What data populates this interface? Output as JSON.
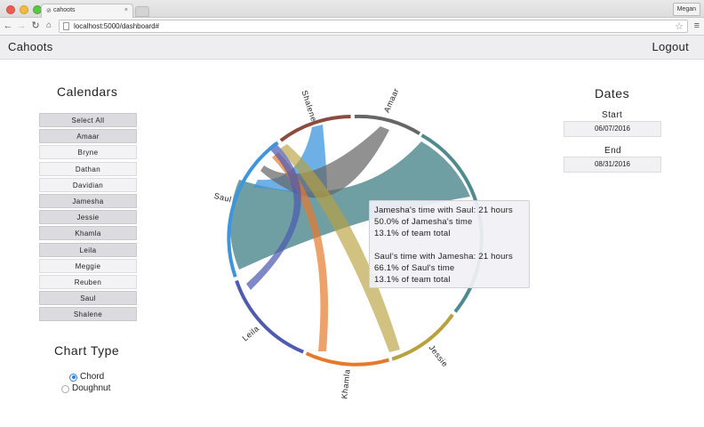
{
  "browser": {
    "tab_title": "cahoots",
    "tab_close": "×",
    "user_button": "Megan",
    "url": "localhost:5000/dashboard#"
  },
  "app": {
    "brand": "Cahoots",
    "logout": "Logout"
  },
  "calendars": {
    "heading": "Calendars",
    "select_all": "Select All",
    "items": [
      {
        "label": "Amaar",
        "selected": true
      },
      {
        "label": "Bryne",
        "selected": false
      },
      {
        "label": "Dathan",
        "selected": false
      },
      {
        "label": "Davidian",
        "selected": false
      },
      {
        "label": "Jamesha",
        "selected": true
      },
      {
        "label": "Jessie",
        "selected": true
      },
      {
        "label": "Khamla",
        "selected": true
      },
      {
        "label": "Leila",
        "selected": true
      },
      {
        "label": "Meggie",
        "selected": false
      },
      {
        "label": "Reuben",
        "selected": false
      },
      {
        "label": "Saul",
        "selected": true
      },
      {
        "label": "Shalene",
        "selected": true
      }
    ]
  },
  "chart_type": {
    "heading": "Chart Type",
    "options": [
      {
        "label": "Chord",
        "checked": true
      },
      {
        "label": "Doughnut",
        "checked": false
      }
    ]
  },
  "dates": {
    "heading": "Dates",
    "start_label": "Start",
    "start_value": "06/07/2016",
    "end_label": "End",
    "end_value": "08/31/2016"
  },
  "chord": {
    "names": [
      "Shalene",
      "Amaar",
      "Jessie",
      "Khamla",
      "Leila",
      "Saul"
    ],
    "colors": {
      "Shalene": "#8b4b3f",
      "Amaar": "#666666",
      "Jamesha": "#4f8a8f",
      "Jessie": "#b8a23e",
      "Khamla": "#e5792c",
      "Leila": "#4e5bb1",
      "Saul": "#3e95dd"
    }
  },
  "tooltip": {
    "line1": "Jamesha's time with Saul: 21 hours",
    "line2": "50.0% of Jamesha's time",
    "line3": "13.1% of team total",
    "line4": "Saul's time with Jamesha: 21 hours",
    "line5": "66.1% of Saul's time",
    "line6": "13.1% of team total"
  }
}
